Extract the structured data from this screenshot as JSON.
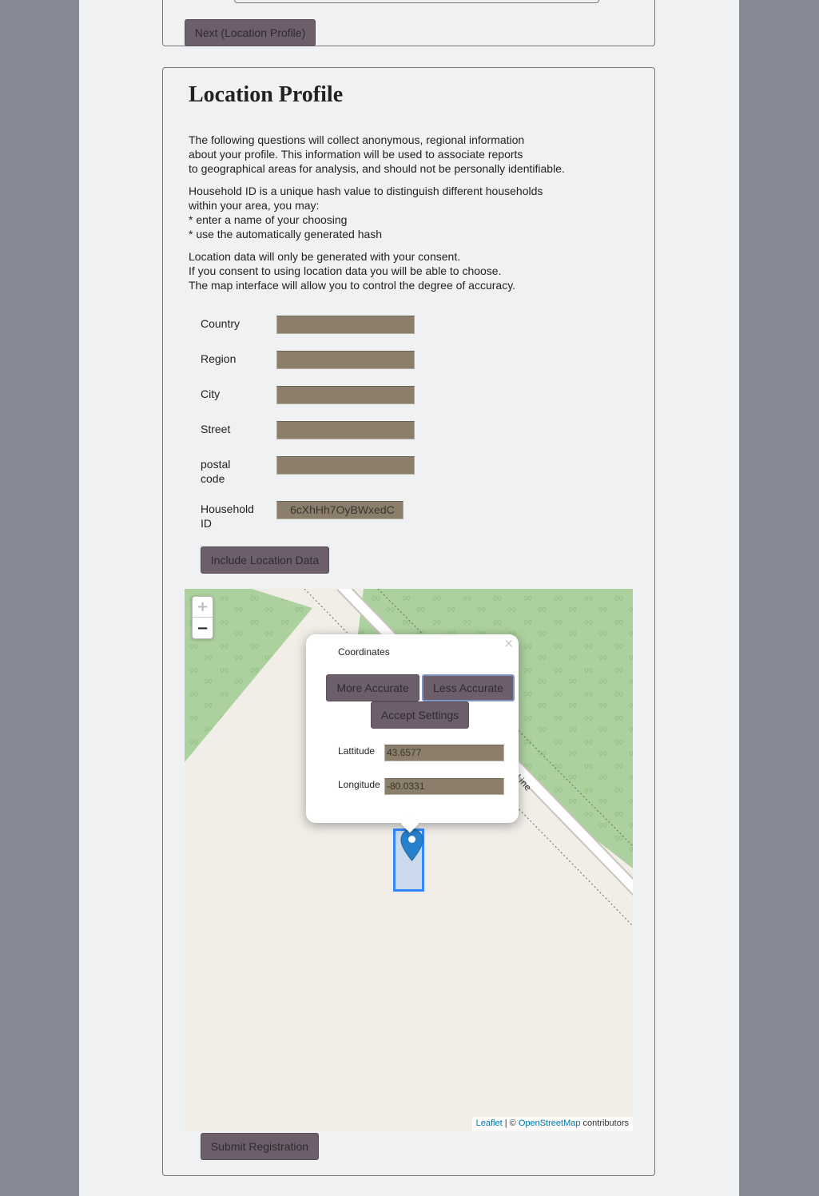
{
  "top_panel": {
    "next_button": "Next (Location Profile)"
  },
  "location_profile": {
    "title": "Location Profile",
    "para1": [
      "The following questions will collect anonymous, regional information",
      "about your profile. This information will be used to associate reports",
      "to geographical areas for analysis, and should not be personally identifiable."
    ],
    "para2": [
      "Household ID is a unique hash value to distinguish different households",
      "within your area, you may:",
      "* enter a name of your choosing",
      "* use the automatically generated hash"
    ],
    "para3": [
      "Location data will only be generated with your consent.",
      "If you consent to using location data you will be able to choose.",
      "The map interface will allow you to control the degree of accuracy."
    ],
    "fields": {
      "country": {
        "label": "Country",
        "value": ""
      },
      "region": {
        "label": "Region",
        "value": ""
      },
      "city": {
        "label": "City",
        "value": ""
      },
      "street": {
        "label": "Street",
        "value": ""
      },
      "postal_code": {
        "label_line1": "postal",
        "label_line2": "code",
        "value": ""
      },
      "household_id": {
        "label_line1": "Household",
        "label_line2": "ID",
        "value": "6cXhHh7OyBWxedC"
      }
    },
    "include_location_button": "Include Location Data",
    "submit_button": "Submit Registration"
  },
  "map": {
    "zoom_in": "+",
    "zoom_out": "−",
    "road_label": "h Line",
    "popup": {
      "close": "×",
      "title": "Coordinates",
      "more_accurate": "More Accurate",
      "less_accurate": "Less Accurate",
      "accept_settings": "Accept Settings",
      "latitude_label": "Lattitude",
      "latitude_value": "43.6577",
      "longitude_label": "Longitude",
      "longitude_value": "-80.0331"
    },
    "attribution": {
      "leaflet": "Leaflet",
      "separator": " | © ",
      "osm": "OpenStreetMap",
      "contributors": " contributors"
    }
  },
  "colors": {
    "background": "#868896",
    "page": "#eff1f3",
    "button": "#6c5e6a",
    "input": "#8b7f6c",
    "park": "#add19e",
    "marker": "#2a81cb",
    "bounds": "#3388ff"
  }
}
